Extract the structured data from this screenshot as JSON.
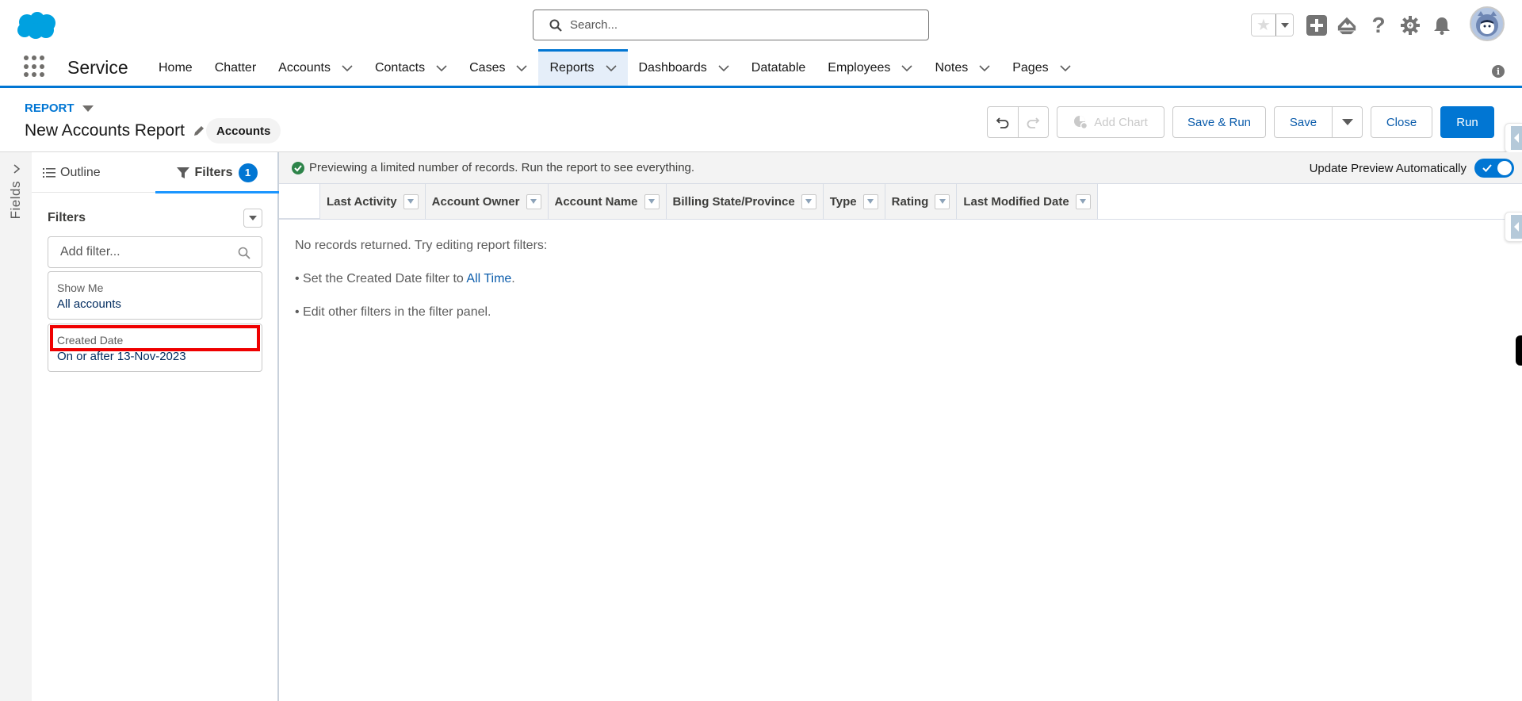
{
  "global_header": {
    "search_placeholder": "Search...",
    "icons": [
      "salesforce-cloud-logo",
      "favorites-star-icon",
      "favorites-dropdown-icon",
      "global-actions-plus-icon",
      "trailhead-icon",
      "help-icon",
      "setup-gear-icon",
      "notifications-bell-icon",
      "user-avatar"
    ]
  },
  "nav": {
    "app_name": "Service",
    "items": [
      {
        "label": "Home",
        "has_menu": false,
        "active": false
      },
      {
        "label": "Chatter",
        "has_menu": false,
        "active": false
      },
      {
        "label": "Accounts",
        "has_menu": true,
        "active": false
      },
      {
        "label": "Contacts",
        "has_menu": true,
        "active": false
      },
      {
        "label": "Cases",
        "has_menu": true,
        "active": false
      },
      {
        "label": "Reports",
        "has_menu": true,
        "active": true
      },
      {
        "label": "Dashboards",
        "has_menu": true,
        "active": false
      },
      {
        "label": "Datatable",
        "has_menu": false,
        "active": false
      },
      {
        "label": "Employees",
        "has_menu": true,
        "active": false
      },
      {
        "label": "Notes",
        "has_menu": true,
        "active": false
      },
      {
        "label": "Pages",
        "has_menu": true,
        "active": false
      }
    ]
  },
  "report_header": {
    "object_label": "REPORT",
    "title": "New Accounts Report",
    "report_type": "Accounts",
    "buttons": {
      "add_chart": "Add Chart",
      "save_and_run": "Save & Run",
      "save": "Save",
      "close": "Close",
      "run": "Run"
    }
  },
  "fields_panel": {
    "label": "Fields"
  },
  "filter_panel": {
    "tabs": {
      "outline": "Outline",
      "filters": "Filters",
      "filters_count": "1"
    },
    "heading": "Filters",
    "add_filter_placeholder": "Add filter...",
    "cards": [
      {
        "label": "Show Me",
        "value": "All accounts"
      },
      {
        "label": "Created Date",
        "value": "On or after 13-Nov-2023"
      }
    ]
  },
  "preview": {
    "banner": "Previewing a limited number of records. Run the report to see everything.",
    "update_toggle_label": "Update Preview Automatically",
    "update_toggle_on": true,
    "columns": [
      "Last Activity",
      "Account Owner",
      "Account Name",
      "Billing State/Province",
      "Type",
      "Rating",
      "Last Modified Date"
    ],
    "empty_message": "No records returned. Try editing report filters:",
    "suggestion_1_prefix": "• Set the Created Date filter to ",
    "suggestion_1_link": "All Time",
    "suggestion_1_suffix": ".",
    "suggestion_2": "• Edit other filters in the filter panel."
  }
}
